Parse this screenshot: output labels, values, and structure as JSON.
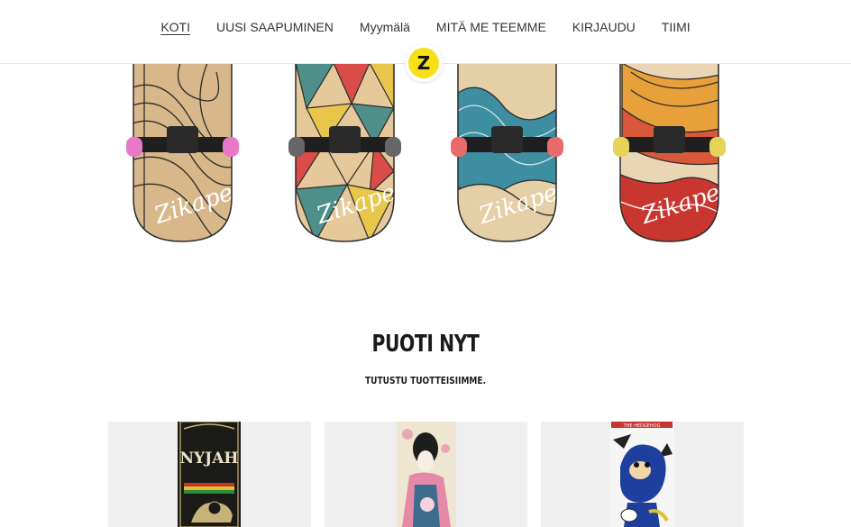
{
  "nav": {
    "items": [
      {
        "label": "KOTI",
        "active": true
      },
      {
        "label": "UUSI SAAPUMINEN",
        "active": false
      },
      {
        "label": "Myymälä",
        "active": false
      },
      {
        "label": "MITÄ ME TEEMME",
        "active": false
      },
      {
        "label": "KIRJAUDU",
        "active": false
      },
      {
        "label": "TIIMI",
        "active": false
      }
    ]
  },
  "logo": {
    "letter": "Z"
  },
  "hero": {
    "brand_text": "Zikape",
    "boards": [
      {
        "name": "line-art",
        "wheel_color": "#e879c8"
      },
      {
        "name": "triangles",
        "wheel_color": "#666666"
      },
      {
        "name": "waves",
        "wheel_color": "#e86a6a"
      },
      {
        "name": "sunset",
        "wheel_color": "#e6d35a"
      }
    ]
  },
  "shop": {
    "title": "PUOTI NYT",
    "subtitle": "TUTUSTU TUOTTEISIIMME."
  },
  "products": [
    {
      "name": "nyjah",
      "deck_text": "NYJAH"
    },
    {
      "name": "geisha",
      "deck_text": ""
    },
    {
      "name": "hedgehog",
      "deck_text": "THE HEDGEHOG"
    }
  ]
}
